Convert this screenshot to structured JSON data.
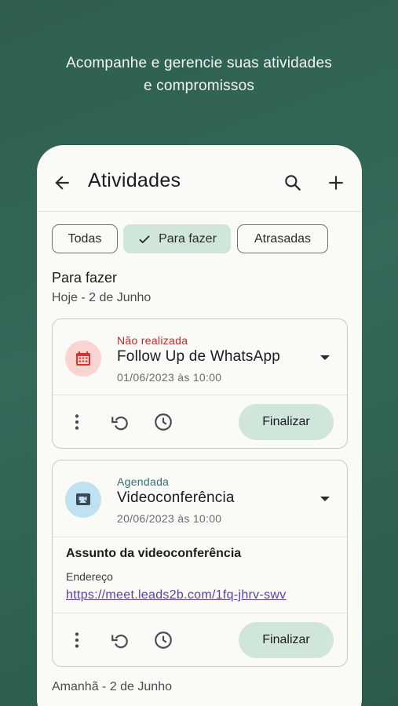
{
  "headline": {
    "line1": "Acompanhe e gerencie suas atividades",
    "line2": "e compromissos"
  },
  "appbar": {
    "title": "Atividades",
    "icons": [
      "back-arrow-icon",
      "search-icon",
      "add-icon"
    ]
  },
  "filters": {
    "chips": [
      {
        "label": "Todas",
        "selected": false
      },
      {
        "label": "Para fazer",
        "selected": true
      },
      {
        "label": "Atrasadas",
        "selected": false
      }
    ]
  },
  "section": {
    "title": "Para fazer",
    "today_label": "Hoje - 2 de Junho",
    "tomorrow_label": "Amanhã - 2 de Junho"
  },
  "cards": [
    {
      "status": "Não realizada",
      "status_color": "#c62828",
      "title": "Follow Up de WhatsApp",
      "date": "01/06/2023 às 10:00",
      "icon": "calendar-icon",
      "icon_bg": "#f9d4d2",
      "icon_color": "#d8322e",
      "finalize_label": "Finalizar"
    },
    {
      "status": "Agendada",
      "status_color": "#2f6f74",
      "title": "Videoconferência",
      "date": "20/06/2023 às 10:00",
      "icon": "video-call-icon",
      "icon_bg": "#bfe2f2",
      "icon_color": "#3a4a55",
      "subject": "Assunto da videoconferência",
      "address_label": "Endereço",
      "address_link": "https://meet.leads2b.com/1fq-jhrv-swv",
      "finalize_label": "Finalizar"
    }
  ]
}
